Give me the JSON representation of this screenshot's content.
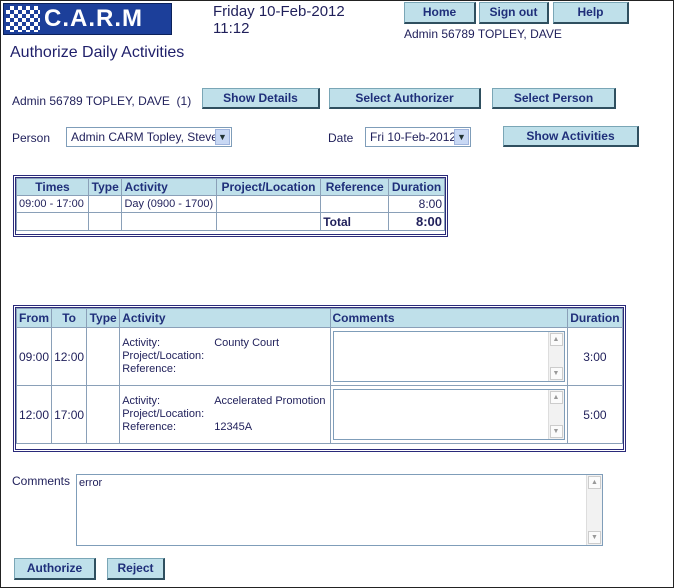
{
  "app": {
    "logo_text": "C.A.R.M"
  },
  "header": {
    "date": "Friday 10-Feb-2012",
    "time": "11:12",
    "user": "Admin 56789 TOPLEY, DAVE",
    "nav": {
      "home": "Home",
      "signout": "Sign out",
      "help": "Help"
    }
  },
  "page": {
    "title": "Authorize Daily Activities"
  },
  "authorizer": {
    "name": "Admin 56789 TOPLEY, DAVE",
    "count": "(1)",
    "show_details": "Show Details",
    "select_authorizer": "Select Authorizer",
    "select_person": "Select Person"
  },
  "filters": {
    "person_label": "Person",
    "person_value": "Admin CARM Topley, Steve",
    "date_label": "Date",
    "date_value": "Fri 10-Feb-2012",
    "show_activities": "Show Activities"
  },
  "summary": {
    "headers": [
      "Times",
      "Type",
      "Activity",
      "Project/Location",
      "Reference",
      "Duration"
    ],
    "rows": [
      {
        "times": "09:00 - 17:00",
        "type": "",
        "activity": "Day (0900 - 1700)",
        "project": "",
        "reference": "",
        "duration": "8:00"
      }
    ],
    "total_label": "Total",
    "total_value": "8:00"
  },
  "detail": {
    "headers": [
      "From",
      "To",
      "Type",
      "Activity",
      "Comments",
      "Duration"
    ],
    "field_labels": {
      "activity": "Activity:",
      "project": "Project/Location:",
      "reference": "Reference:"
    },
    "rows": [
      {
        "from": "09:00",
        "to": "12:00",
        "type": "",
        "activity": "County Court",
        "project": "",
        "reference": "",
        "comment": "",
        "duration": "3:00"
      },
      {
        "from": "12:00",
        "to": "17:00",
        "type": "",
        "activity": "Accelerated Promotion",
        "project": "",
        "reference": "12345A",
        "comment": "",
        "duration": "5:00"
      }
    ]
  },
  "comments": {
    "label": "Comments",
    "value": "error"
  },
  "actions": {
    "authorize": "Authorize",
    "reject": "Reject"
  },
  "colors": {
    "brand": "#1c3f9a",
    "button_bg": "#bfe0ea",
    "table_border": "#2a2a7a"
  }
}
